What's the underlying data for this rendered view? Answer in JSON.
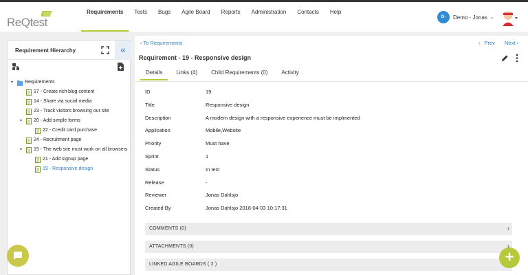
{
  "header": {
    "logo_text": "ReQtest",
    "nav": [
      {
        "label": "Requirements",
        "active": true
      },
      {
        "label": "Tests",
        "active": false
      },
      {
        "label": "Bugs",
        "active": false
      },
      {
        "label": "Agile Board",
        "active": false
      },
      {
        "label": "Reports",
        "active": false
      },
      {
        "label": "Administration",
        "active": false
      },
      {
        "label": "Contacts",
        "active": false
      },
      {
        "label": "Help",
        "active": false
      }
    ],
    "user": {
      "avatar_initials": "D-",
      "name": "Demo - Jonas"
    }
  },
  "left_panel": {
    "title": "Requirement Hierarchy",
    "tree": [
      {
        "label": "Requirements",
        "level": 0,
        "caret": "▾",
        "type": "folder"
      },
      {
        "label": "17 - Create rich blog content",
        "level": 1,
        "type": "doc"
      },
      {
        "label": "14 - Share via social media",
        "level": 1,
        "type": "doc"
      },
      {
        "label": "23 - Track visitors browsing our site",
        "level": 1,
        "type": "doc"
      },
      {
        "label": "20 - Add simple forms",
        "level": 1,
        "caret": "▾",
        "type": "doc"
      },
      {
        "label": "22 - Credit card purchase",
        "level": 2,
        "type": "doc"
      },
      {
        "label": "24 - Recruitment page",
        "level": 1,
        "type": "doc"
      },
      {
        "label": "15 - The web site must work on all browsers",
        "level": 1,
        "caret": "▾",
        "type": "doc"
      },
      {
        "label": "21 - Add signup page",
        "level": 2,
        "type": "doc"
      },
      {
        "label": "19 - Responsive design",
        "level": 2,
        "type": "doc",
        "selected": true
      }
    ]
  },
  "main": {
    "back_link": "To Requirements",
    "prev_label": "Prev",
    "next_label": "Next",
    "title": "Requirement - 19 - Responsive design",
    "tabs": [
      {
        "label": "Details",
        "active": true
      },
      {
        "label": "Links (4)",
        "active": false
      },
      {
        "label": "Child Requirements (0)",
        "active": false
      },
      {
        "label": "Activity",
        "active": false
      }
    ],
    "fields": [
      {
        "label": "ID",
        "value": "19"
      },
      {
        "label": "Title",
        "value": "Responsive design"
      },
      {
        "label": "Description",
        "value": "A modern design with a responsive experience must be implmented"
      },
      {
        "label": "Application",
        "value": "Mobile,Website"
      },
      {
        "label": "Priority",
        "value": "Must have"
      },
      {
        "label": "Sprint",
        "value": "1"
      },
      {
        "label": "Status",
        "value": "In test"
      },
      {
        "label": "Release",
        "value": "-"
      },
      {
        "label": "Reviewer",
        "value": "Jonas Dahlsjo"
      },
      {
        "label": "Created By",
        "value": "Jonas Dahlsjo  2018-04-03 10:17:31"
      }
    ],
    "sections": [
      {
        "label": "COMMENTS (0)"
      },
      {
        "label": "ATTACHMENTS (0)"
      },
      {
        "label": "LINKED AGILE BOARDS ( 2 )"
      }
    ]
  },
  "fab_label": "+",
  "colors": {
    "accent": "#b5c93b",
    "link": "#2f7fc0",
    "avatar": "#2f8bd6"
  }
}
